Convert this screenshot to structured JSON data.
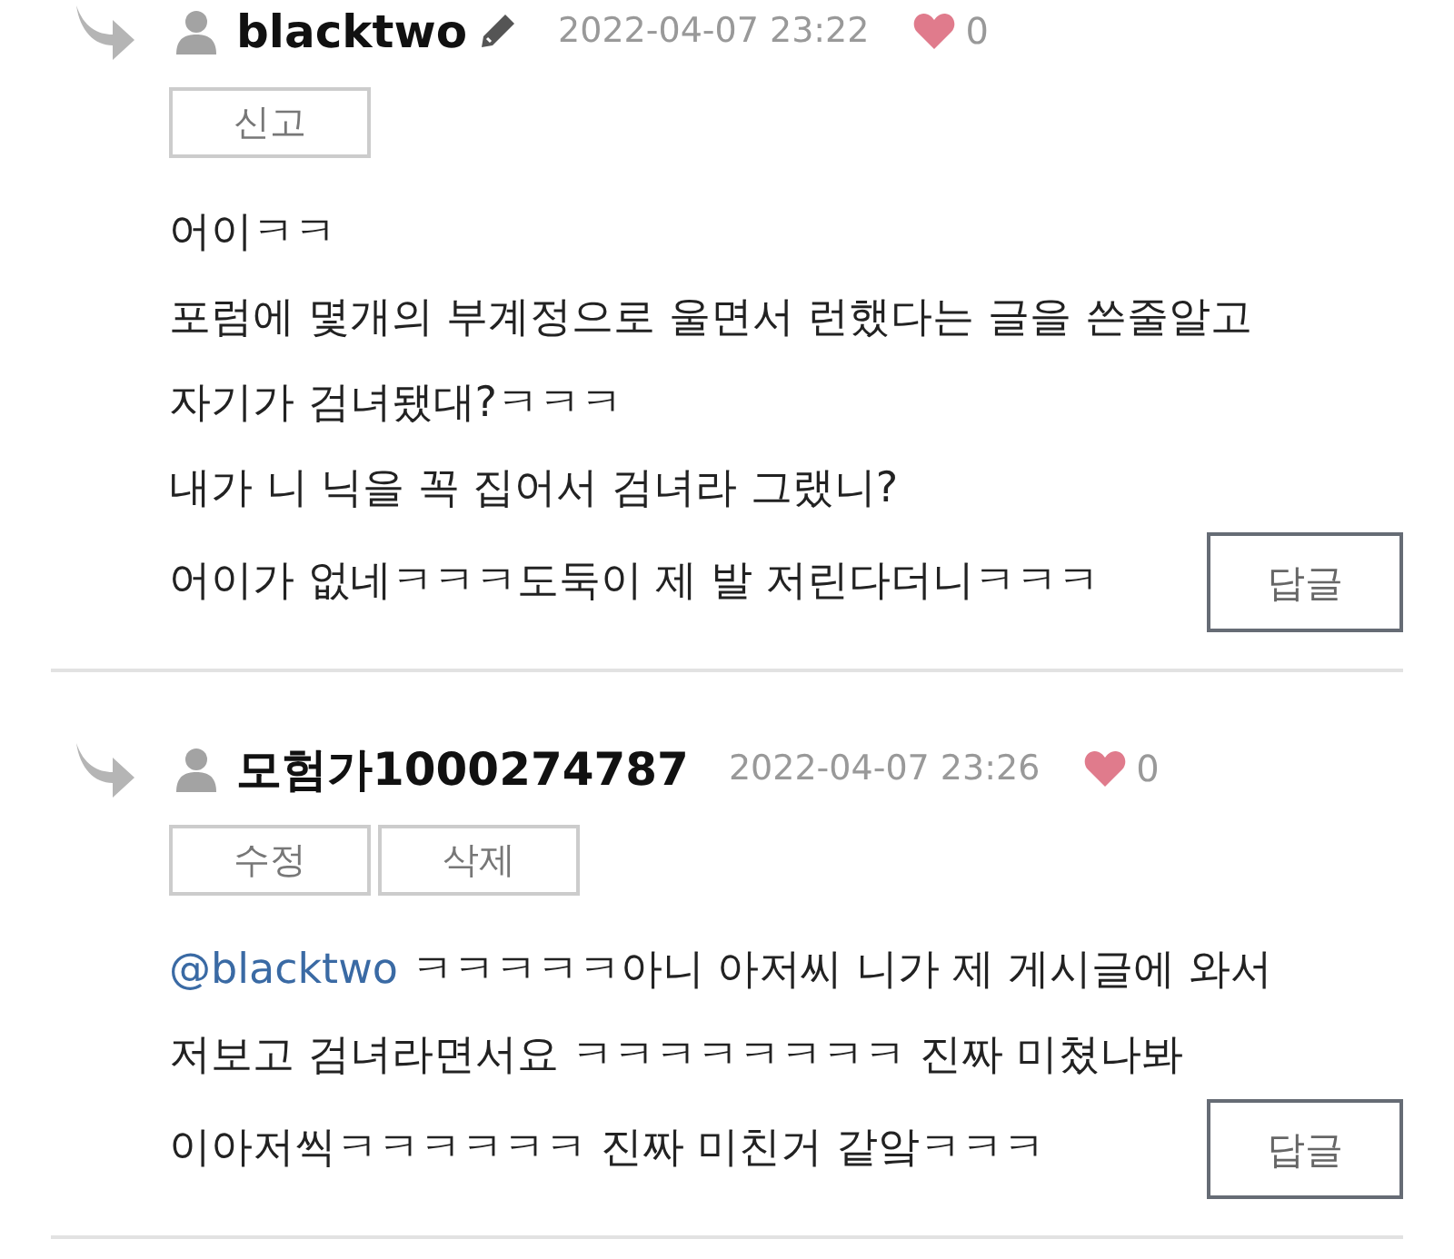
{
  "comments": [
    {
      "author": "blacktwo",
      "edited": true,
      "date": "2022-04-07 23:22",
      "likes": "0",
      "actions": [
        "신고"
      ],
      "lines": [
        "어이ㅋㅋ",
        "포럼에 몇개의 부계정으로 울면서 런했다는 글을 쓴줄알고",
        "자기가 검녀됐대?ㅋㅋㅋ",
        "내가 니 닉을 꼭 집어서 검녀라 그랬니?",
        "어이가 없네ㅋㅋㅋ도둑이 제 발 저린다더니ㅋㅋㅋ"
      ],
      "reply": "답글"
    },
    {
      "author": "모험가1000274787",
      "edited": false,
      "date": "2022-04-07 23:26",
      "likes": "0",
      "actions": [
        "수정",
        "삭제"
      ],
      "mention": "@blacktwo",
      "lines": [
        "ㅋㅋㅋㅋㅋ아니 아저씨 니가 제 게시글에 와서",
        "저보고 검녀라면서요 ㅋㅋㅋㅋㅋㅋㅋㅋ 진짜 미쳤나봐",
        "이아저씩ㅋㅋㅋㅋㅋㅋ 진짜 미친거 같앜ㅋㅋㅋ"
      ],
      "reply": "답글"
    }
  ]
}
